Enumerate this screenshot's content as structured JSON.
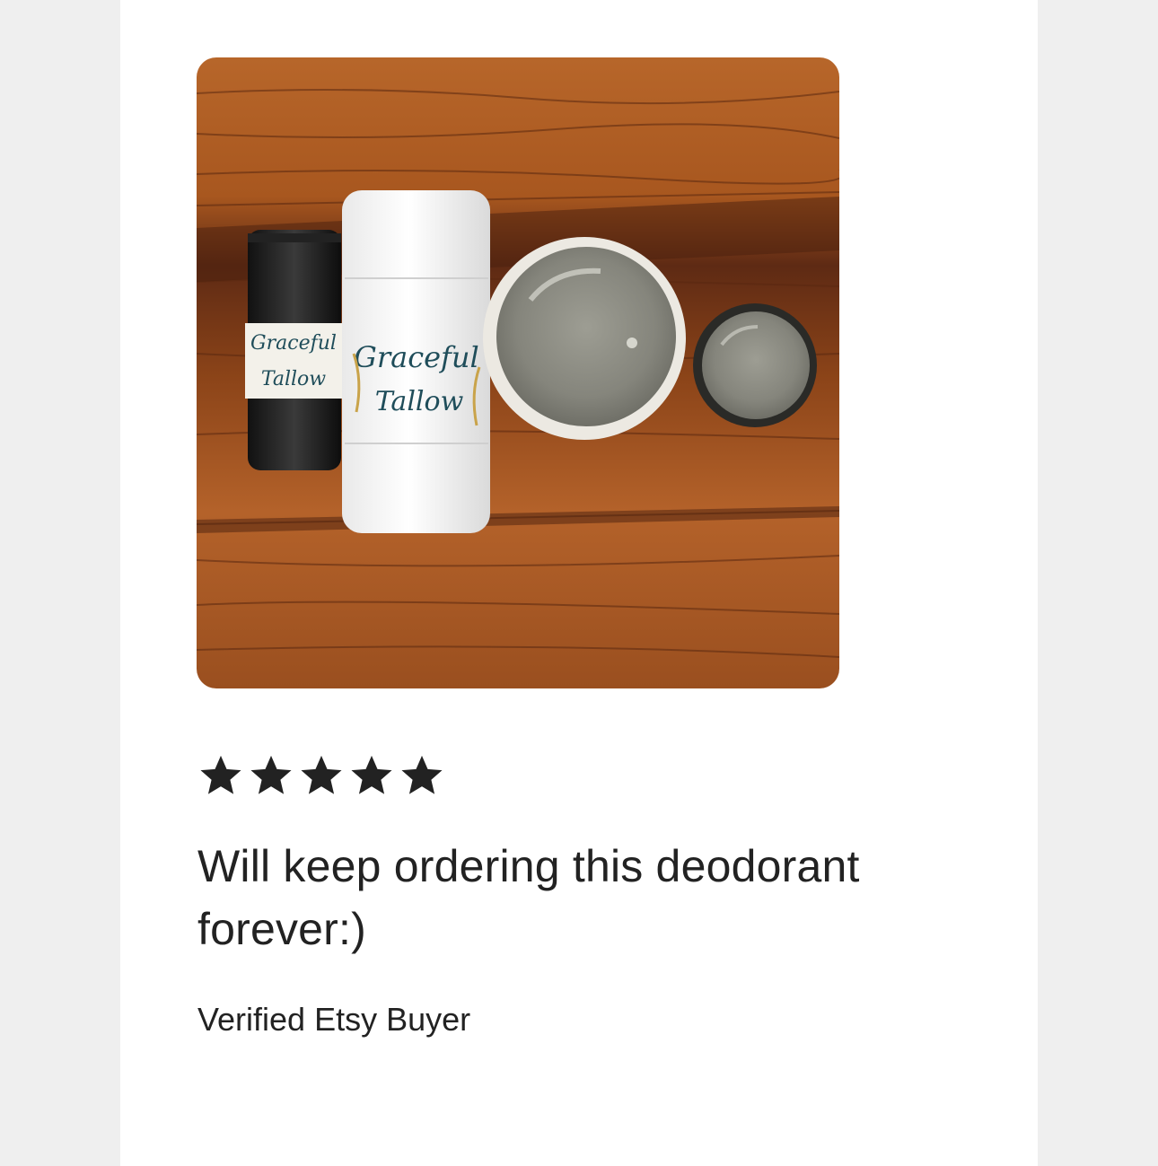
{
  "review": {
    "photo": {
      "alt": "Photo of Graceful Tallow deodorant sticks and tins on a wooden table",
      "label_line1": "Graceful",
      "label_line2": "Tallow"
    },
    "rating": {
      "value": 5,
      "max": 5,
      "icon": "star-icon",
      "color": "#222222"
    },
    "headline": "Will keep ordering this deodorant forever:)",
    "reviewer": "Verified Etsy Buyer"
  }
}
